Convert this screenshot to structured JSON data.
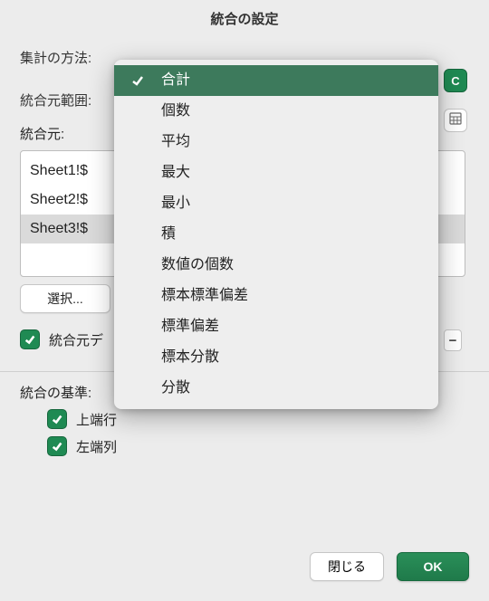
{
  "header": {
    "title": "統合の設定"
  },
  "labels": {
    "function": "集計の方法:",
    "reference": "統合元範囲:",
    "sources": "統合元:",
    "select": "選択...",
    "link_sources": "統合元デ",
    "criteria": "統合の基準:",
    "top_row": "上端行",
    "left_col": "左端列",
    "close": "閉じる",
    "ok": "OK"
  },
  "sources_list": [
    "Sheet1!$",
    "Sheet2!$",
    "Sheet3!$"
  ],
  "selected_source_index": 2,
  "dropdown": {
    "selected_index": 0,
    "options": [
      "合計",
      "個数",
      "平均",
      "最大",
      "最小",
      "積",
      "数値の個数",
      "標本標準偏差",
      "標準偏差",
      "標本分散",
      "分散"
    ]
  },
  "side_icons": {
    "refresh": "refresh-icon",
    "grid": "grid-icon",
    "minus": "−"
  },
  "checkboxes": {
    "link": true,
    "top_row": true,
    "left_col": true
  },
  "colors": {
    "accent": "#1f8a53",
    "dropdown_highlight": "#3d7a5c"
  }
}
